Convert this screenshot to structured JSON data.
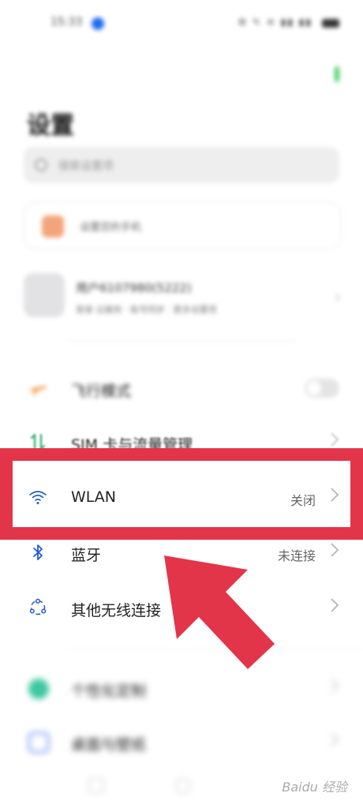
{
  "status_bar": {
    "time": "15:33",
    "icons": "⚙ ✎ ≋ ▮▮ ▮▮"
  },
  "page": {
    "title": "设置"
  },
  "search": {
    "placeholder": "搜索设置项"
  },
  "card": {
    "text": "设置您的手机"
  },
  "account": {
    "name": "用户6107980(5222)",
    "subtitle": "登录 云服务 · 账号同步 · 更多设置项"
  },
  "settings": {
    "airplane": {
      "label": "飞行模式"
    },
    "sim": {
      "label": "SIM 卡与流量管理"
    },
    "wlan": {
      "label": "WLAN",
      "value": "关闭"
    },
    "bluetooth": {
      "label": "蓝牙",
      "value": "未连接"
    },
    "other_wireless": {
      "label": "其他无线连接"
    },
    "personalize": {
      "label": "个性化定制"
    },
    "desktop": {
      "label": "桌面与壁纸"
    }
  },
  "watermark": {
    "text": "Baidu 经验"
  },
  "colors": {
    "highlight": "#e3354a",
    "wifi_icon": "#1e5bd8",
    "bluetooth_icon": "#1e5bd8"
  }
}
